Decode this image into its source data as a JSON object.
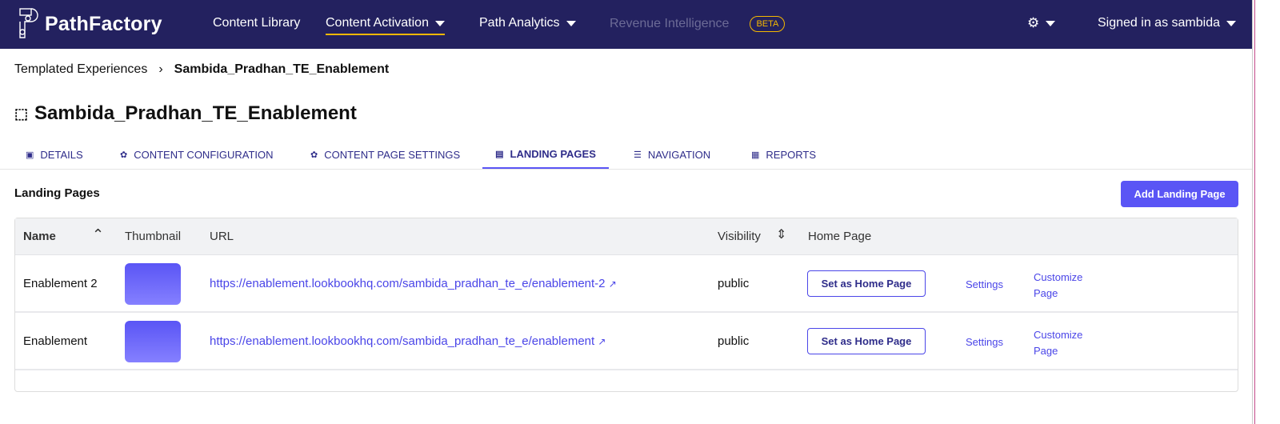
{
  "nav": {
    "brand": "PathFactory",
    "items": [
      {
        "label": "Content Library"
      },
      {
        "label": "Content Activation"
      },
      {
        "label": "Path Analytics"
      },
      {
        "label": "Revenue Intelligence"
      }
    ],
    "beta": "BETA",
    "user": "Signed in as sambida"
  },
  "breadcrumb": {
    "parent": "Templated Experiences",
    "current": "Sambida_Pradhan_TE_Enablement"
  },
  "page_title": "Sambida_Pradhan_TE_Enablement",
  "tabs": [
    {
      "label": "DETAILS"
    },
    {
      "label": "CONTENT CONFIGURATION"
    },
    {
      "label": "CONTENT PAGE SETTINGS"
    },
    {
      "label": "LANDING PAGES"
    },
    {
      "label": "NAVIGATION"
    },
    {
      "label": "REPORTS"
    }
  ],
  "section": {
    "title": "Landing Pages",
    "add_label": "Add Landing Page"
  },
  "table": {
    "headers": {
      "name": "Name",
      "thumbnail": "Thumbnail",
      "url": "URL",
      "visibility": "Visibility",
      "home": "Home Page"
    },
    "rows": [
      {
        "name": "Enablement 2",
        "url": "https://enablement.lookbookhq.com/sambida_pradhan_te_e/enablement-2",
        "visibility": "public",
        "home_btn": "Set as Home Page",
        "settings": "Settings",
        "customize1": "Customize",
        "customize2": "Page"
      },
      {
        "name": "Enablement",
        "url": "https://enablement.lookbookhq.com/sambida_pradhan_te_e/enablement",
        "visibility": "public",
        "home_btn": "Set as Home Page",
        "settings": "Settings",
        "customize1": "Customize",
        "customize2": "Page"
      }
    ]
  }
}
